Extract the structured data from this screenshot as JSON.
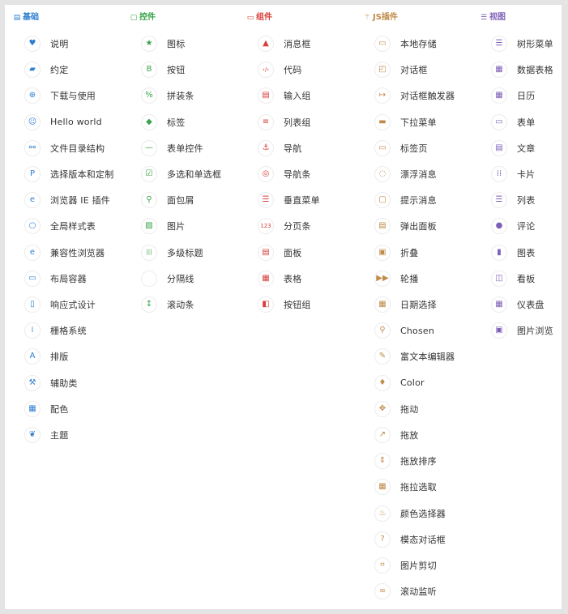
{
  "colors": {
    "basics": "#2f7fd0",
    "controls": "#38a34a",
    "components": "#d8403b",
    "js_plugins": "#c08a4a",
    "views": "#7d5fb8"
  },
  "columns": [
    {
      "key": "basics",
      "title": "基础",
      "icon": "book-icon",
      "glyph": "▤",
      "items": [
        {
          "label": "说明",
          "icon": "heart-icon",
          "glyph": "♥"
        },
        {
          "label": "约定",
          "icon": "eraser-icon",
          "glyph": "▰"
        },
        {
          "label": "下载与使用",
          "icon": "download-icon",
          "glyph": "⊕"
        },
        {
          "label": "Hello world",
          "icon": "smile-icon",
          "glyph": "☺"
        },
        {
          "label": "文件目录结构",
          "icon": "sitemap-icon",
          "glyph": "⚯"
        },
        {
          "label": "选择版本和定制",
          "icon": "product-icon",
          "glyph": "P"
        },
        {
          "label": "浏览器 IE 插件",
          "icon": "ie-icon",
          "glyph": "e"
        },
        {
          "label": "全局样式表",
          "icon": "circle-o-icon",
          "glyph": "○"
        },
        {
          "label": "兼容性浏览器",
          "icon": "ie-icon",
          "glyph": "e"
        },
        {
          "label": "布局容器",
          "icon": "window-icon",
          "glyph": "▭"
        },
        {
          "label": "响应式设计",
          "icon": "mobile-icon",
          "glyph": "▯"
        },
        {
          "label": "栅格系统",
          "icon": "grid-icon",
          "glyph": "⁞"
        },
        {
          "label": "排版",
          "icon": "font-icon",
          "glyph": "A"
        },
        {
          "label": "辅助类",
          "icon": "wrench-icon",
          "glyph": "⚒"
        },
        {
          "label": "配色",
          "icon": "cubes-icon",
          "glyph": "▦"
        },
        {
          "label": "主题",
          "icon": "leaf-icon",
          "glyph": "❦"
        }
      ]
    },
    {
      "key": "controls",
      "title": "控件",
      "icon": "square-o-icon",
      "glyph": "▢",
      "items": [
        {
          "label": "图标",
          "icon": "star-icon",
          "glyph": "★"
        },
        {
          "label": "按钮",
          "icon": "bold-icon",
          "glyph": "B"
        },
        {
          "label": "拼装条",
          "icon": "percent-icon",
          "glyph": "%"
        },
        {
          "label": "标签",
          "icon": "tags-icon",
          "glyph": "◆"
        },
        {
          "label": "表单控件",
          "icon": "minus-icon",
          "glyph": "—"
        },
        {
          "label": "多选和单选框",
          "icon": "check-square-icon",
          "glyph": "☑"
        },
        {
          "label": "面包屑",
          "icon": "map-marker-icon",
          "glyph": "⚲"
        },
        {
          "label": "图片",
          "icon": "picture-icon",
          "glyph": "▨"
        },
        {
          "label": "多级标题",
          "icon": "header-icon",
          "glyph": "|||"
        },
        {
          "label": "分隔线",
          "icon": "divider-icon",
          "glyph": ""
        },
        {
          "label": "滚动条",
          "icon": "resize-vertical-icon",
          "glyph": "↕"
        }
      ]
    },
    {
      "key": "components",
      "title": "组件",
      "icon": "window-icon",
      "glyph": "▭",
      "items": [
        {
          "label": "消息框",
          "icon": "warning-icon",
          "glyph": "▲"
        },
        {
          "label": "代码",
          "icon": "code-icon",
          "glyph": "‹/›"
        },
        {
          "label": "输入组",
          "icon": "inbox-icon",
          "glyph": "▤"
        },
        {
          "label": "列表组",
          "icon": "list-icon",
          "glyph": "≡"
        },
        {
          "label": "导航",
          "icon": "anchor-icon",
          "glyph": "⚓"
        },
        {
          "label": "导航条",
          "icon": "compass-icon",
          "glyph": "◎"
        },
        {
          "label": "垂直菜单",
          "icon": "list-ul-icon",
          "glyph": "☰"
        },
        {
          "label": "分页条",
          "icon": "pager-icon",
          "glyph": "123"
        },
        {
          "label": "面板",
          "icon": "panel-icon",
          "glyph": "▤"
        },
        {
          "label": "表格",
          "icon": "table-icon",
          "glyph": "▦"
        },
        {
          "label": "按钮组",
          "icon": "columns-icon",
          "glyph": "◧"
        }
      ]
    },
    {
      "key": "js_plugins",
      "title": "JS插件",
      "icon": "magic-icon",
      "glyph": "⚚",
      "items": [
        {
          "label": "本地存储",
          "icon": "database-icon",
          "glyph": "▭"
        },
        {
          "label": "对话框",
          "icon": "window-icon",
          "glyph": "◰"
        },
        {
          "label": "对话框触发器",
          "icon": "external-link-icon",
          "glyph": "↦"
        },
        {
          "label": "下拉菜单",
          "icon": "dropdown-icon",
          "glyph": "▬"
        },
        {
          "label": "标签页",
          "icon": "tabs-icon",
          "glyph": "▭"
        },
        {
          "label": "漂浮消息",
          "icon": "comment-o-icon",
          "glyph": "◌"
        },
        {
          "label": "提示消息",
          "icon": "chat-icon",
          "glyph": "▢"
        },
        {
          "label": "弹出面板",
          "icon": "popover-icon",
          "glyph": "▤"
        },
        {
          "label": "折叠",
          "icon": "collapse-icon",
          "glyph": "▣"
        },
        {
          "label": "轮播",
          "icon": "forward-icon",
          "glyph": "▶▶"
        },
        {
          "label": "日期选择",
          "icon": "calendar-icon",
          "glyph": "▦"
        },
        {
          "label": "Chosen",
          "icon": "search-icon",
          "glyph": "⚲"
        },
        {
          "label": "富文本编辑器",
          "icon": "edit-icon",
          "glyph": "✎"
        },
        {
          "label": "Color",
          "icon": "tint-icon",
          "glyph": "♦"
        },
        {
          "label": "拖动",
          "icon": "move-icon",
          "glyph": "✥"
        },
        {
          "label": "拖放",
          "icon": "share-icon",
          "glyph": "↗"
        },
        {
          "label": "拖放排序",
          "icon": "sort-icon",
          "glyph": "⇕"
        },
        {
          "label": "拖拉选取",
          "icon": "grid-icon",
          "glyph": "▦"
        },
        {
          "label": "颜色选择器",
          "icon": "fire-icon",
          "glyph": "♨"
        },
        {
          "label": "模态对话框",
          "icon": "question-icon",
          "glyph": "?"
        },
        {
          "label": "图片剪切",
          "icon": "crop-icon",
          "glyph": "⌗"
        },
        {
          "label": "滚动监听",
          "icon": "link-icon",
          "glyph": "∞"
        }
      ]
    },
    {
      "key": "views",
      "title": "视图",
      "icon": "list-alt-icon",
      "glyph": "☰",
      "items": [
        {
          "label": "树形菜单",
          "icon": "list-icon",
          "glyph": "☰"
        },
        {
          "label": "数据表格",
          "icon": "table-icon",
          "glyph": "▦"
        },
        {
          "label": "日历",
          "icon": "calendar-icon",
          "glyph": "▦"
        },
        {
          "label": "表单",
          "icon": "form-icon",
          "glyph": "▭"
        },
        {
          "label": "文章",
          "icon": "file-text-icon",
          "glyph": "▤"
        },
        {
          "label": "卡片",
          "icon": "th-icon",
          "glyph": "⁞⁞"
        },
        {
          "label": "列表",
          "icon": "list-icon",
          "glyph": "☰"
        },
        {
          "label": "评论",
          "icon": "comments-icon",
          "glyph": "●"
        },
        {
          "label": "图表",
          "icon": "bar-chart-icon",
          "glyph": "▮"
        },
        {
          "label": "看板",
          "icon": "columns-icon",
          "glyph": "◫"
        },
        {
          "label": "仪表盘",
          "icon": "dashboard-icon",
          "glyph": "▦"
        },
        {
          "label": "图片浏览",
          "icon": "image-icon",
          "glyph": "▣"
        }
      ]
    }
  ]
}
